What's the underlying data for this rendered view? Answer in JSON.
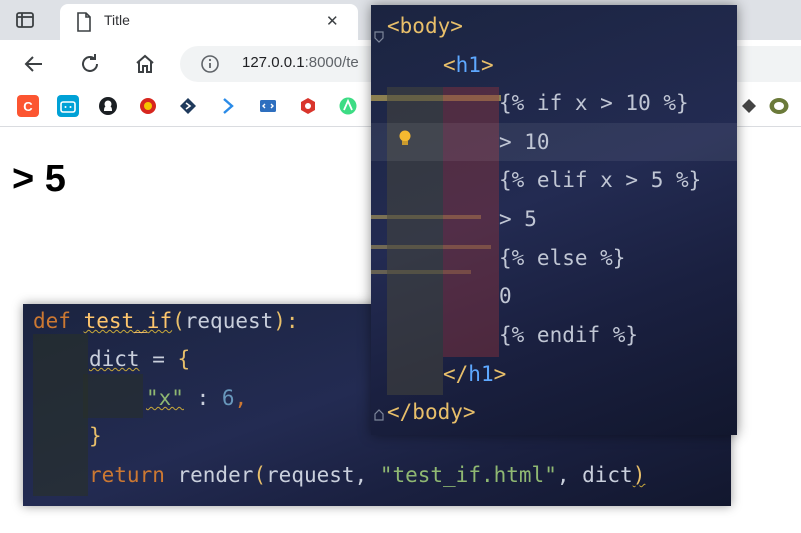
{
  "browser": {
    "tab_title": "Title",
    "url_host": "127.0.0.1",
    "url_rest": ":8000/te"
  },
  "bookmarks": [
    {
      "icon": "csdn-icon",
      "letter": "C",
      "color": "#fc5531"
    },
    {
      "icon": "bilibili-icon",
      "letter": "",
      "color": "#00a1d6"
    },
    {
      "icon": "github-icon",
      "letter": "",
      "color": "#1b1f23"
    },
    {
      "icon": "party-emblem-icon",
      "letter": "",
      "color": "#d7261e"
    },
    {
      "icon": "diamond-icon",
      "letter": "",
      "color": "#1f3a5c"
    },
    {
      "icon": "flow-icon",
      "letter": "",
      "color": "#2a8be8"
    },
    {
      "icon": "code-window-icon",
      "letter": "",
      "color": "#2e6fbf"
    },
    {
      "icon": "hexagon-icon",
      "letter": "",
      "color": "#d9352c"
    },
    {
      "icon": "android-studio-icon",
      "letter": "",
      "color": "#3ddc84"
    }
  ],
  "page": {
    "heading": "> 5"
  },
  "python_code": {
    "def": "def",
    "fn_name": "test_if",
    "open_paren": "(",
    "param": "request",
    "close": "):",
    "dict_var": "dict",
    "assign": " = ",
    "brace_open": "{",
    "key": "\"x\"",
    "colon": " : ",
    "num": "6",
    "comma": ",",
    "brace_close": "}",
    "return_kw": "return",
    "render_fn": " render",
    "args_open": "(",
    "arg1": "request, ",
    "arg2": "\"test_if.html\"",
    "arg3": ", dict",
    "args_close": ")"
  },
  "template_code": {
    "body_open_lt": "<",
    "body_name": "body",
    "body_open_gt": ">",
    "h1_lt": "<",
    "h1_name": "h1",
    "h1_gt": ">",
    "if_line": "{% if x > 10 %}",
    "gt10": "> 10",
    "elif_line": "{% elif x > 5 %}",
    "gt5": "> 5",
    "else_line": "{% else %}",
    "zero": "0",
    "endif_line": "{% endif %}",
    "h1_close_lt": "</",
    "h1_close_name": "h1",
    "h1_close_gt": ">",
    "body_close_lt": "</",
    "body_close_name": "body",
    "body_close_gt": ">"
  }
}
